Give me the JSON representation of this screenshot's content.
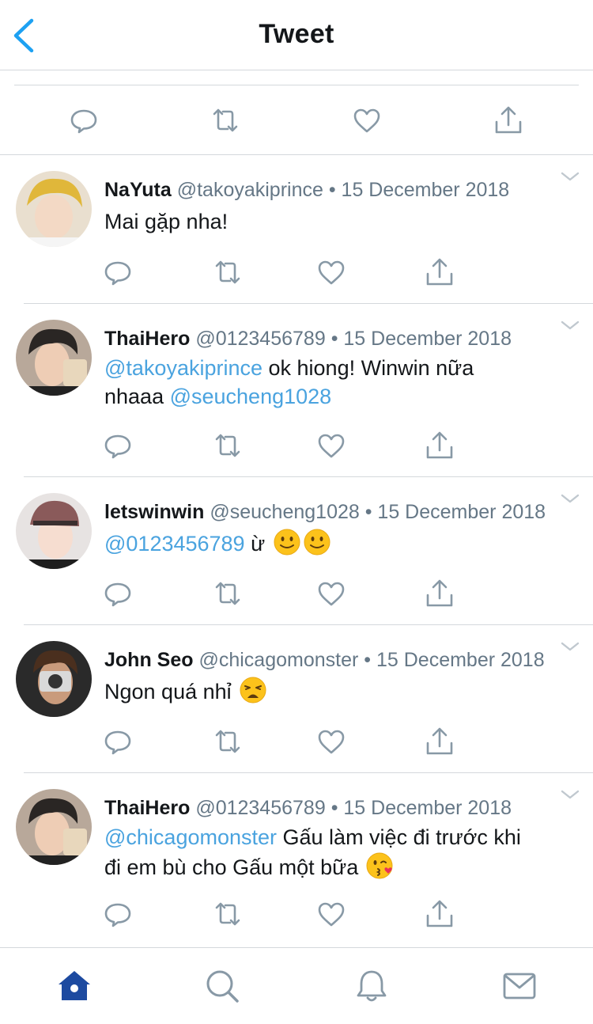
{
  "header": {
    "title": "Tweet",
    "back_icon": "chevron-left-icon"
  },
  "main_tweet_actions": [
    "reply-icon",
    "retweet-icon",
    "like-icon",
    "share-icon"
  ],
  "replies": [
    {
      "name": "NaYuta",
      "handle": "@takoyakiprince",
      "date": "• 15 December 2018",
      "text_parts": [
        {
          "t": "Mai gặp nha!"
        }
      ]
    },
    {
      "name": "ThaiHero",
      "handle": "@0123456789",
      "date": "• 15 December 2018",
      "text_parts": [
        {
          "t": "@takoyakiprince",
          "mention": true
        },
        {
          "t": " ok hiong! Winwin nữa nhaaa "
        },
        {
          "t": "@seucheng1028",
          "mention": true
        }
      ]
    },
    {
      "name": "letswinwin",
      "handle": "@seucheng1028",
      "date": "• 15 December 2018",
      "text_parts": [
        {
          "t": "@0123456789",
          "mention": true
        },
        {
          "t": " ừ "
        },
        {
          "emoji": "slightly-smiling-face"
        },
        {
          "emoji": "slightly-smiling-face"
        }
      ]
    },
    {
      "name": "John Seo",
      "handle": "@chicagomonster",
      "date": "• 15 December 2018",
      "text_parts": [
        {
          "t": "Ngon quá nhỉ "
        },
        {
          "emoji": "weary-face"
        }
      ]
    },
    {
      "name": "ThaiHero",
      "handle": "@0123456789",
      "date": "• 15 December 2018",
      "text_parts": [
        {
          "t": "@chicagomonster",
          "mention": true
        },
        {
          "t": " Gấu làm việc đi trước khi đi em bù cho Gấu một bữa "
        },
        {
          "emoji": "face-blowing-kiss"
        }
      ]
    }
  ],
  "tabbar": {
    "items": [
      "home-icon",
      "search-icon",
      "notifications-icon",
      "messages-icon"
    ],
    "active": "home-icon",
    "active_color": "#1d4aa0",
    "inactive_color": "#8899a6"
  },
  "colors": {
    "mention": "#4aa3df",
    "accent": "#1da1f2",
    "secondary_text": "#657786",
    "icon_gray": "#8899a6"
  }
}
